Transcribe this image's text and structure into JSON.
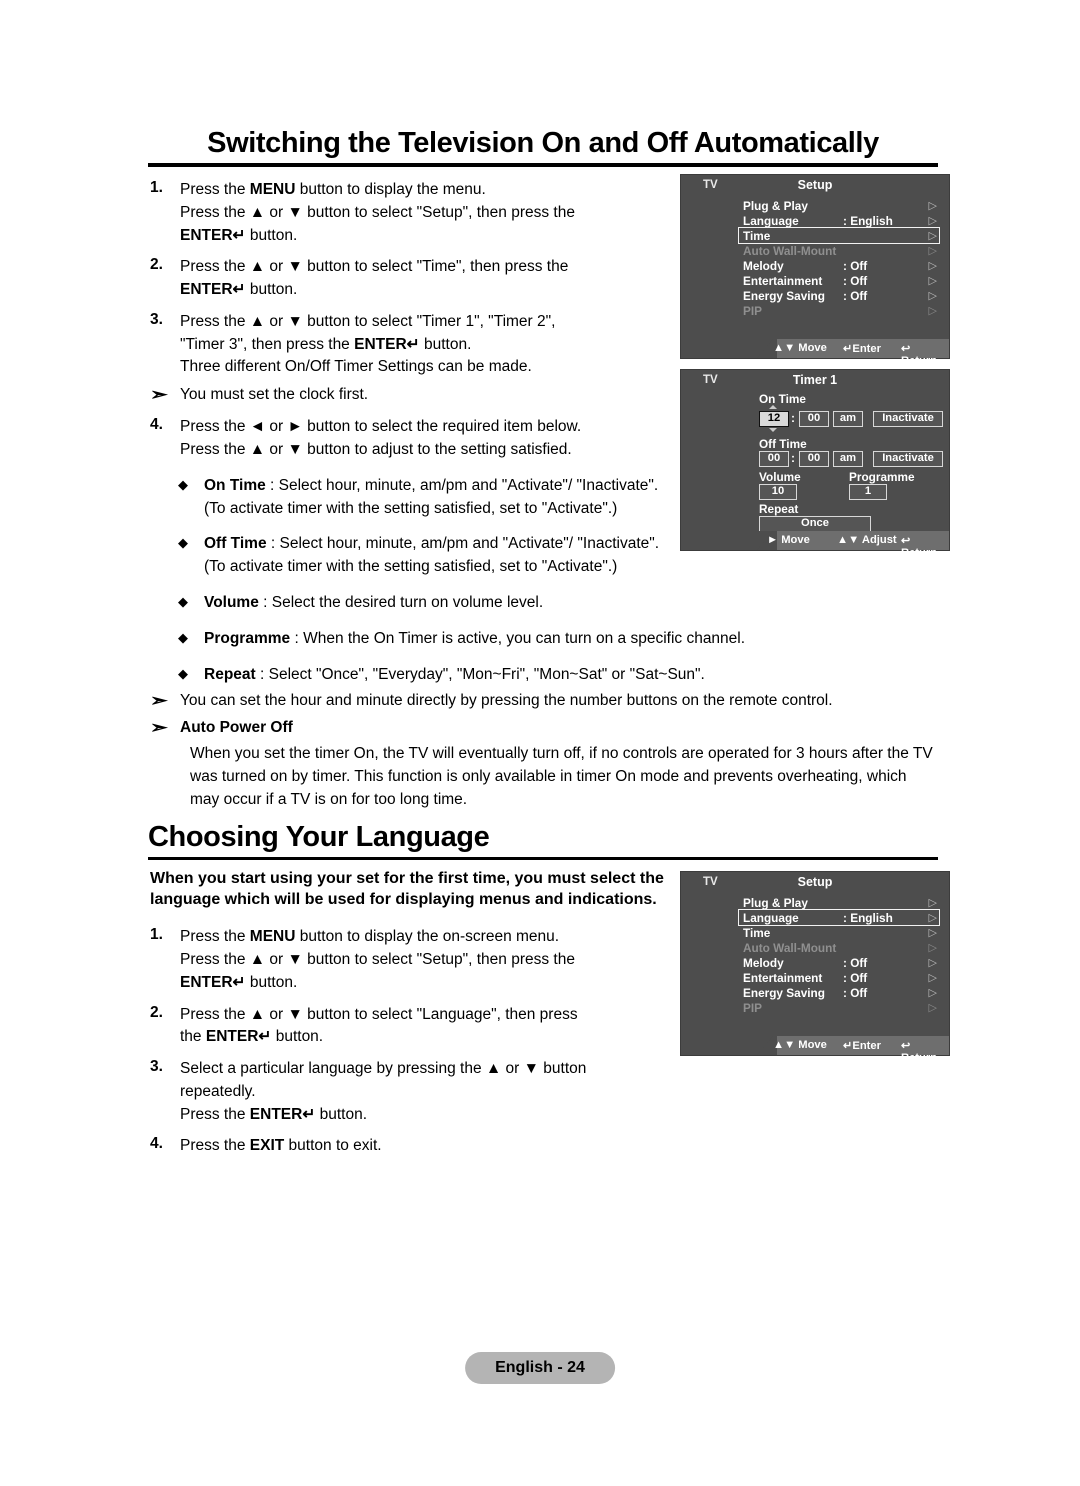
{
  "sections": [
    {
      "title": "Switching the Television On and Off Automatically",
      "steps": [
        {
          "num": "1.",
          "lines": [
            "Press the MENU button to display the menu.",
            "Press the ▲ or ▼ button to select \"Setup\", then press the",
            "ENTER↵ button."
          ]
        },
        {
          "num": "2.",
          "lines": [
            "Press the ▲ or ▼ button to select \"Time\", then press the",
            "ENTER↵ button."
          ]
        },
        {
          "num": "3.",
          "lines": [
            "Press the ▲ or ▼ button to select \"Timer 1\", \"Timer 2\",",
            "\"Timer 3\", then press the ENTER↵ button.",
            "Three different On/Off Timer Settings can be made."
          ]
        }
      ],
      "note1": "You must set the clock first.",
      "step4": {
        "num": "4.",
        "lines": [
          "Press the ◄ or ► button to select the required item below.",
          "Press the ▲ or ▼ button to adjust to the setting satisfied."
        ]
      },
      "bullets": [
        {
          "term": "On Time",
          "rest": " : Select hour, minute, am/pm and \"Activate\"/ \"Inactivate\". (To activate timer with the setting satisfied, set to \"Activate\".)"
        },
        {
          "term": "Off Time",
          "rest": " : Select hour, minute, am/pm and \"Activate\"/ \"Inactivate\". (To activate timer with the setting satisfied, set to \"Activate\".)"
        },
        {
          "term": "Volume",
          "rest": " : Select the desired turn on volume level."
        },
        {
          "term": "Programme",
          "rest": " : When the On Timer is active, you can turn on a specific channel."
        },
        {
          "term": "Repeat",
          "rest": " : Select \"Once\", \"Everyday\", \"Mon~Fri\", \"Mon~Sat\" or \"Sat~Sun\"."
        }
      ],
      "note2": "You can set the hour and minute directly by pressing the number buttons on the remote control.",
      "note3_title": "Auto Power Off",
      "note3_body": "When you set the timer On, the TV will eventually turn off, if no controls are operated for 3 hours after the TV was turned on by timer. This function is only available in timer On mode and prevents overheating, which may occur if a TV is on for too long time."
    },
    {
      "title": "Choosing Your Language",
      "lead": "When you start using your set for the first time, you must select the language which will be used for displaying menus and indications.",
      "steps": [
        {
          "num": "1.",
          "lines": [
            "Press the MENU button to display the on-screen menu.",
            "Press the ▲ or ▼ button to select \"Setup\", then press the",
            "ENTER↵ button."
          ]
        },
        {
          "num": "2.",
          "lines": [
            "Press the ▲ or ▼ button to select \"Language\", then press",
            "the ENTER↵ button."
          ]
        },
        {
          "num": "3.",
          "lines": [
            "Select a particular language by pressing the ▲ or ▼ button",
            "repeatedly.",
            "Press the ENTER↵ button."
          ]
        },
        {
          "num": "4.",
          "lines": [
            "Press the EXIT button to exit."
          ]
        }
      ]
    }
  ],
  "osd_setup_top": {
    "source": "TV",
    "title": "Setup",
    "rows": [
      {
        "label": "Plug & Play",
        "value": "",
        "dim": false,
        "selected": false
      },
      {
        "label": "Language",
        "value": ": English",
        "dim": false,
        "selected": false
      },
      {
        "label": "Time",
        "value": "",
        "dim": false,
        "selected": true
      },
      {
        "label": "Auto Wall-Mount",
        "value": "",
        "dim": true,
        "selected": false
      },
      {
        "label": "Melody",
        "value": ": Off",
        "dim": false,
        "selected": false
      },
      {
        "label": "Entertainment",
        "value": ": Off",
        "dim": false,
        "selected": false
      },
      {
        "label": "Energy Saving",
        "value": ": Off",
        "dim": false,
        "selected": false
      },
      {
        "label": "PIP",
        "value": "",
        "dim": true,
        "selected": false
      }
    ],
    "footer": {
      "move": "Move",
      "enter": "Enter",
      "return": "Return"
    }
  },
  "osd_timer": {
    "source": "TV",
    "title": "Timer 1",
    "on_time_label": "On Time",
    "on_hour": "12",
    "on_min": "00",
    "on_ampm": "am",
    "on_state": "Inactivate",
    "off_time_label": "Off Time",
    "off_hour": "00",
    "off_min": "00",
    "off_ampm": "am",
    "off_state": "Inactivate",
    "volume_label": "Volume",
    "volume_value": "10",
    "programme_label": "Programme",
    "programme_value": "1",
    "repeat_label": "Repeat",
    "repeat_value": "Once",
    "footer": {
      "move": "Move",
      "adjust": "Adjust",
      "return": "Return"
    }
  },
  "osd_setup_bottom": {
    "source": "TV",
    "title": "Setup",
    "rows": [
      {
        "label": "Plug & Play",
        "value": "",
        "dim": false,
        "selected": false
      },
      {
        "label": "Language",
        "value": ": English",
        "dim": false,
        "selected": true
      },
      {
        "label": "Time",
        "value": "",
        "dim": false,
        "selected": false
      },
      {
        "label": "Auto Wall-Mount",
        "value": "",
        "dim": true,
        "selected": false
      },
      {
        "label": "Melody",
        "value": ": Off",
        "dim": false,
        "selected": false
      },
      {
        "label": "Entertainment",
        "value": ": Off",
        "dim": false,
        "selected": false
      },
      {
        "label": "Energy Saving",
        "value": ": Off",
        "dim": false,
        "selected": false
      },
      {
        "label": "PIP",
        "value": "",
        "dim": true,
        "selected": false
      }
    ],
    "footer": {
      "move": "Move",
      "enter": "Enter",
      "return": "Return"
    }
  },
  "footer": {
    "page_label": "English - 24"
  },
  "colors": {
    "osd_bg": "#4d4d4d",
    "osd_footer_bg": "#6e6e6e",
    "osd_dim_text": "#8f8f8f",
    "pill_bg": "#b4b4b4",
    "rule": "#000000"
  }
}
